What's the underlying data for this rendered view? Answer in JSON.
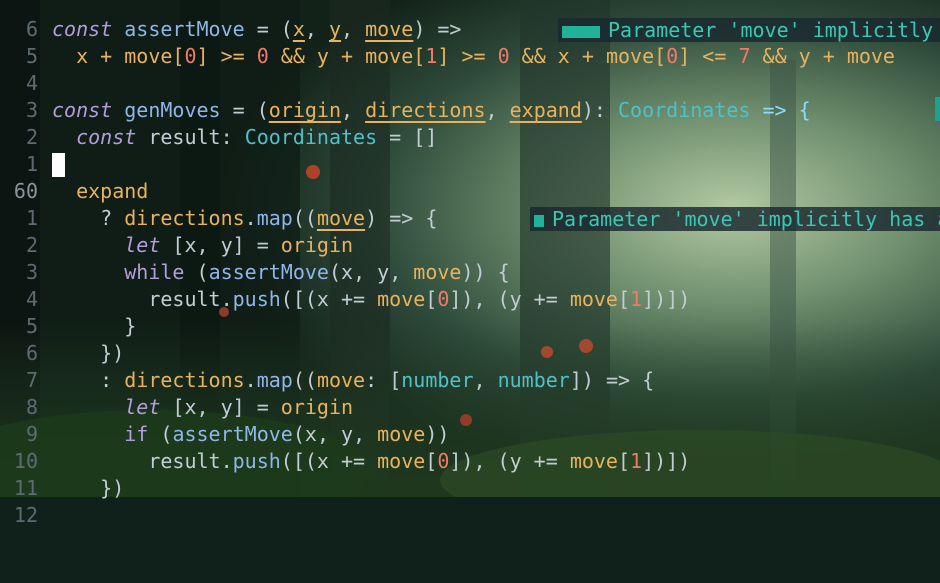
{
  "editor": {
    "lines": [
      {
        "num": "6"
      },
      {
        "num": "5",
        "code": [
          "const",
          " ",
          "assertMove",
          " = (",
          "x",
          ", ",
          "y",
          ", ",
          "move",
          ") =>"
        ]
      },
      {
        "num": "4",
        "code": [
          "  x + move[",
          "0",
          "] >= ",
          "0",
          " && y + move[",
          "1",
          "] >= ",
          "0",
          " && x + move[",
          "0",
          "] <= ",
          "7",
          " && y + move"
        ]
      },
      {
        "num": "3"
      },
      {
        "num": "2",
        "code": [
          "const",
          " ",
          "genMoves",
          " = (",
          "origin",
          ", ",
          "directions",
          ", ",
          "expand",
          "): ",
          "Coordinates",
          " => {"
        ]
      },
      {
        "num": "1",
        "code": [
          "  ",
          "const",
          " result: ",
          "Coordinates",
          " = []"
        ]
      },
      {
        "num": "60"
      },
      {
        "num": "1",
        "code": [
          "  expand"
        ]
      },
      {
        "num": "2",
        "code": [
          "    ? ",
          "directions",
          ".",
          "map",
          "((",
          "move",
          ") => {"
        ]
      },
      {
        "num": "3",
        "code": [
          "      ",
          "let",
          " [x, y] = ",
          "origin"
        ]
      },
      {
        "num": "4",
        "code": [
          "      ",
          "while",
          " (",
          "assertMove",
          "(x, y, ",
          "move",
          ")) {"
        ]
      },
      {
        "num": "5",
        "code": [
          "        ",
          "result",
          ".",
          "push",
          "([(x += ",
          "move",
          "[",
          "0",
          "]), (y += ",
          "move",
          "[",
          "1",
          "])])"
        ]
      },
      {
        "num": "6",
        "code": [
          "      }"
        ]
      },
      {
        "num": "7",
        "code": [
          "    })"
        ]
      },
      {
        "num": "8",
        "code": [
          "    : ",
          "directions",
          ".",
          "map",
          "((",
          "move",
          ": [",
          "number",
          ", ",
          "number",
          "]) => {"
        ]
      },
      {
        "num": "9",
        "code": [
          "      ",
          "let",
          " [x, y] = ",
          "origin"
        ]
      },
      {
        "num": "10",
        "code": [
          "      ",
          "if",
          " (",
          "assertMove",
          "(x, y, ",
          "move",
          "))"
        ]
      },
      {
        "num": "11",
        "code": [
          "        ",
          "result",
          ".",
          "push",
          "([(x += ",
          "move",
          "[",
          "0",
          "]), (y += ",
          "move",
          "[",
          "1",
          "])])"
        ]
      },
      {
        "num": "12",
        "code": [
          "    })"
        ]
      }
    ]
  },
  "diagnostics": {
    "line5": "Parameter 'move' implicitly has an 'any' type.",
    "line2": "Parameter 'move' implicitly has an 'any' type."
  },
  "colors": {
    "keyword": "#b39ddb",
    "function": "#8fb6e8",
    "variable": "#e8b25e",
    "type": "#4fc1c9",
    "number": "#f07a6a",
    "diagnostic": "#3cc7b4"
  }
}
